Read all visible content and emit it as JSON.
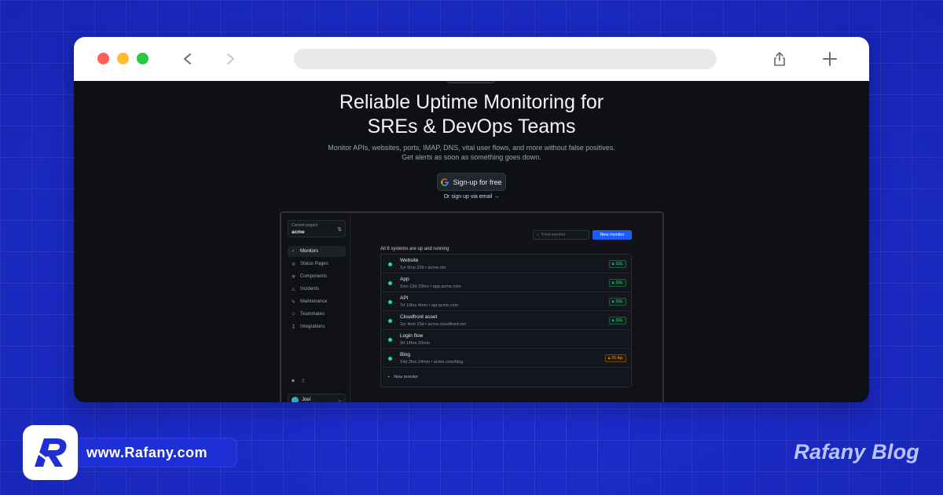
{
  "hero": {
    "title_line1": "Reliable Uptime Monitoring for",
    "title_line2": "SREs & DevOps Teams",
    "subtitle_line1": "Monitor APIs, websites, ports, IMAP, DNS, vital user flows, and more without false positives.",
    "subtitle_line2": "Get alerts as soon as something goes down.",
    "signup_label": "Sign-up for free",
    "email_link": "Or sign up via email →"
  },
  "app": {
    "project_label": "Current project",
    "project_name": "acme",
    "nav": [
      {
        "label": "Monitors",
        "icon": "monitor-icon"
      },
      {
        "label": "Status Pages",
        "icon": "wifi-icon"
      },
      {
        "label": "Components",
        "icon": "puzzle-icon"
      },
      {
        "label": "Incidents",
        "icon": "alert-icon"
      },
      {
        "label": "Maintenance",
        "icon": "wrench-icon"
      },
      {
        "label": "Teammates",
        "icon": "users-icon"
      },
      {
        "label": "Integrations",
        "icon": "plug-icon"
      }
    ],
    "user_name": "Joel",
    "find_placeholder": "Find monitor",
    "new_monitor_label": "New monitor",
    "status_text": "All 6 systems are up and running",
    "monitors": [
      {
        "name": "Website",
        "meta": "1yr 9mo 22d • acme.om",
        "tag": "SSL",
        "tag_type": "ok"
      },
      {
        "name": "App",
        "meta": "1mo 13d 15hrs • app.acme.com",
        "tag": "SSL",
        "tag_type": "ok"
      },
      {
        "name": "API",
        "meta": "7d 19hrs 4min • api.acme.com",
        "tag": "SSL",
        "tag_type": "ok"
      },
      {
        "name": "Cloudfront asset",
        "meta": "2yr 4mo 15d • acme.cloudfront.net",
        "tag": "SSL",
        "tag_type": "ok"
      },
      {
        "name": "Login flow",
        "meta": "9d 14hrs 20min",
        "tag": "",
        "tag_type": "none"
      },
      {
        "name": "Blog",
        "meta": "14d 2hrs 24min • acme.com/blog",
        "tag": "05 Apr",
        "tag_type": "warn"
      }
    ],
    "add_monitor_label": "New monitor"
  },
  "branding": {
    "url": "www.Rafany.com",
    "blog_name": "Rafany Blog"
  },
  "colors": {
    "background": "#1f2fd6",
    "accent": "#1d5cff",
    "status_ok": "#34d399",
    "status_warn": "#f59e0b"
  }
}
